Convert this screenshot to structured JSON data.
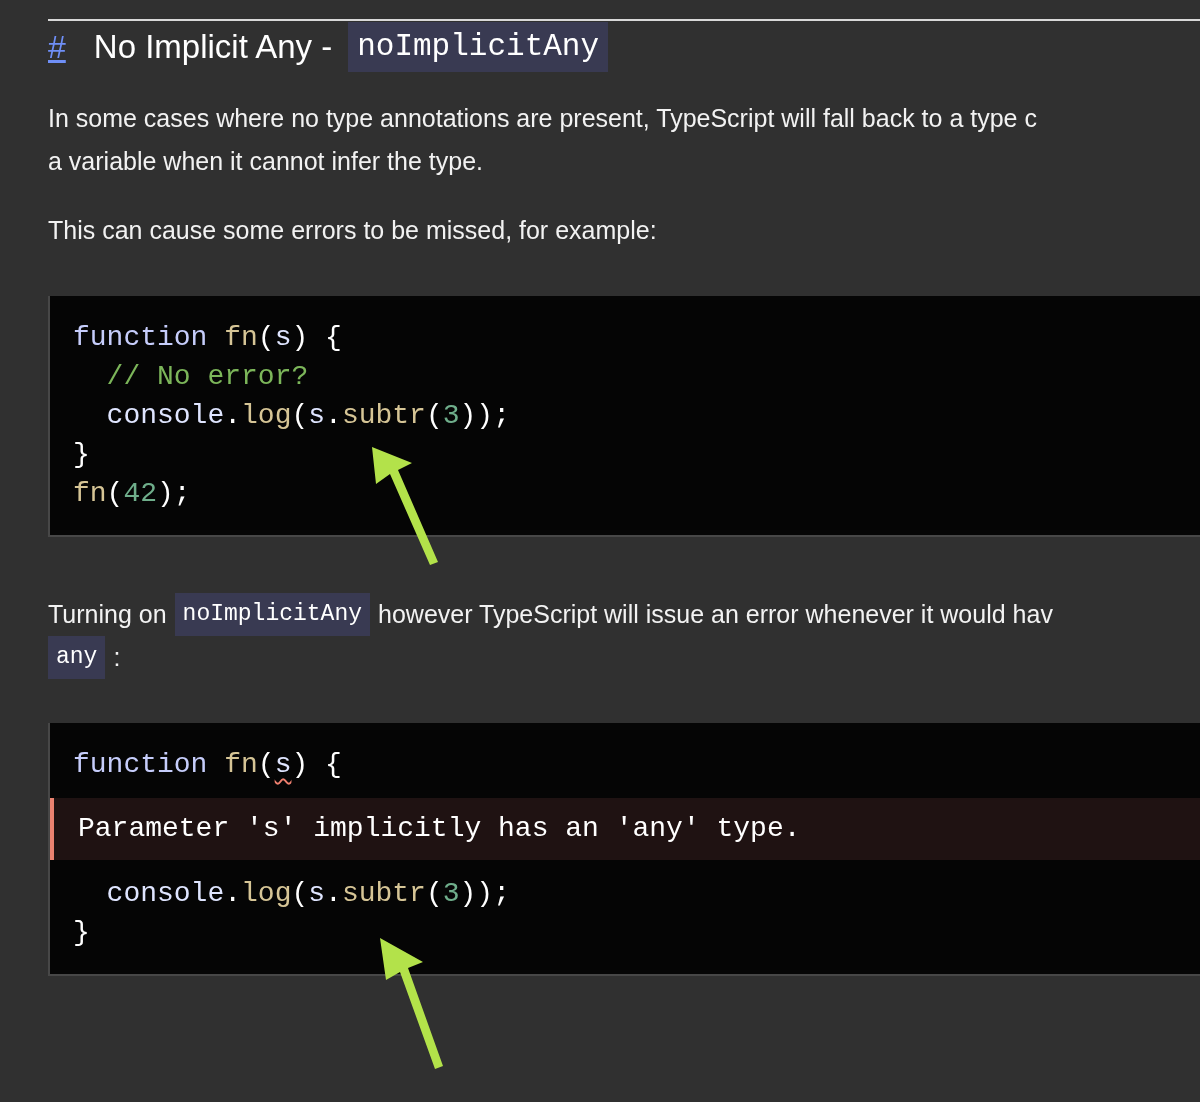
{
  "heading": {
    "anchor": "#",
    "title": "No Implicit Any -",
    "code": "noImplicitAny"
  },
  "sections": [
    {
      "kind": "paragraph",
      "lines": [
        [
          {
            "kind": "text",
            "text": "In some cases where no type annotations are present, TypeScript will fall back to a type c"
          }
        ],
        [
          {
            "kind": "text",
            "text": "a variable when it cannot infer the type."
          }
        ]
      ]
    },
    {
      "kind": "paragraph",
      "lines": [
        [
          {
            "kind": "text",
            "text": "This can cause some errors to be missed, for example:"
          }
        ]
      ]
    },
    {
      "kind": "code",
      "lines": [
        {
          "kind": "code",
          "tokens": [
            {
              "kind": "keyword",
              "text": "function "
            },
            {
              "kind": "function",
              "text": "fn"
            },
            {
              "kind": "punct",
              "text": "("
            },
            {
              "kind": "variable",
              "text": "s"
            },
            {
              "kind": "punct",
              "text": ") {"
            }
          ]
        },
        {
          "kind": "code",
          "tokens": [
            {
              "kind": "comment",
              "text": "  // No error?"
            }
          ]
        },
        {
          "kind": "code",
          "tokens": [
            {
              "kind": "variable",
              "text": "  console"
            },
            {
              "kind": "punct",
              "text": "."
            },
            {
              "kind": "function",
              "text": "log"
            },
            {
              "kind": "punct",
              "text": "("
            },
            {
              "kind": "variable",
              "text": "s"
            },
            {
              "kind": "punct",
              "text": "."
            },
            {
              "kind": "function",
              "text": "subtr"
            },
            {
              "kind": "punct",
              "text": "("
            },
            {
              "kind": "number",
              "text": "3"
            },
            {
              "kind": "punct",
              "text": "));"
            }
          ]
        },
        {
          "kind": "code",
          "tokens": [
            {
              "kind": "punct",
              "text": "}"
            }
          ]
        },
        {
          "kind": "code",
          "tokens": [
            {
              "kind": "function",
              "text": "fn"
            },
            {
              "kind": "punct",
              "text": "("
            },
            {
              "kind": "number",
              "text": "42"
            },
            {
              "kind": "punct",
              "text": ");"
            }
          ]
        }
      ]
    },
    {
      "kind": "paragraph",
      "lines": [
        [
          {
            "kind": "text",
            "text": "Turning on"
          },
          {
            "kind": "code",
            "text": "noImplicitAny"
          },
          {
            "kind": "text",
            "text": "however TypeScript will issue an error whenever it would hav"
          }
        ],
        [
          {
            "kind": "code",
            "text": "any"
          },
          {
            "kind": "text",
            "text": ":"
          }
        ]
      ]
    },
    {
      "kind": "code",
      "lines": [
        {
          "kind": "code",
          "tokens": [
            {
              "kind": "keyword",
              "text": "function "
            },
            {
              "kind": "function",
              "text": "fn"
            },
            {
              "kind": "punct",
              "text": "("
            },
            {
              "kind": "variable",
              "text": "s",
              "error_mark": true
            },
            {
              "kind": "punct",
              "text": ") {"
            }
          ]
        },
        {
          "kind": "error",
          "text": "Parameter 's' implicitly has an 'any' type."
        },
        {
          "kind": "code",
          "tokens": [
            {
              "kind": "variable",
              "text": "  console"
            },
            {
              "kind": "punct",
              "text": "."
            },
            {
              "kind": "function",
              "text": "log"
            },
            {
              "kind": "punct",
              "text": "("
            },
            {
              "kind": "variable",
              "text": "s"
            },
            {
              "kind": "punct",
              "text": "."
            },
            {
              "kind": "function",
              "text": "subtr"
            },
            {
              "kind": "punct",
              "text": "("
            },
            {
              "kind": "number",
              "text": "3"
            },
            {
              "kind": "punct",
              "text": "));"
            }
          ]
        },
        {
          "kind": "code",
          "tokens": [
            {
              "kind": "punct",
              "text": "}"
            }
          ]
        }
      ]
    }
  ]
}
